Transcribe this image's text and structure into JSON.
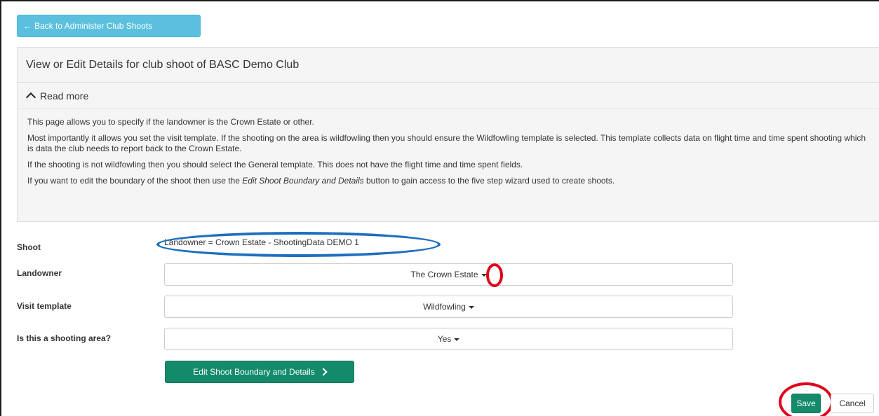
{
  "back_button": {
    "label": "Back to Administer Club Shoots"
  },
  "panel": {
    "title": "View or Edit Details for club shoot of BASC Demo Club",
    "read_more_label": "Read more",
    "paragraphs": {
      "p1": "This page allows you to specify if the landowner is the Crown Estate or other.",
      "p2": "Most importantly it allows you set the visit template. If the shooting on the area is wildfowling then you should ensure the Wildfowling template is selected. This template collects data on flight time and time spent shooting which is data the club needs to report back to the Crown Estate.",
      "p3": "If the shooting is not wildfowling then you should select the General template. This does not have the flight time and time spent fields.",
      "p4_before": "If you want to edit the boundary of the shoot then use the ",
      "p4_emph": "Edit Shoot Boundary and Details",
      "p4_after": " button to gain access to the five step wizard used to create shoots."
    }
  },
  "form": {
    "shoot_label": "Shoot",
    "shoot_value": "Landowner = Crown Estate - ShootingData DEMO 1",
    "landowner_label": "Landowner",
    "landowner_value": "The Crown Estate",
    "visit_template_label": "Visit template",
    "visit_template_value": "Wildfowling",
    "shooting_area_label": "Is this a shooting area?",
    "shooting_area_value": "Yes",
    "edit_boundary_label": "Edit Shoot Boundary and Details"
  },
  "actions": {
    "save_label": "Save",
    "cancel_label": "Cancel"
  },
  "colors": {
    "info_button": "#5bc0de",
    "primary_button": "#138a6a",
    "annotation_blue": "#1f6fbf",
    "annotation_red": "#e0001b"
  },
  "icons": {
    "back": "arrow-left-icon",
    "read_more": "chevron-up-icon",
    "dropdown": "caret-down-icon",
    "edit": "chevron-right-icon"
  }
}
